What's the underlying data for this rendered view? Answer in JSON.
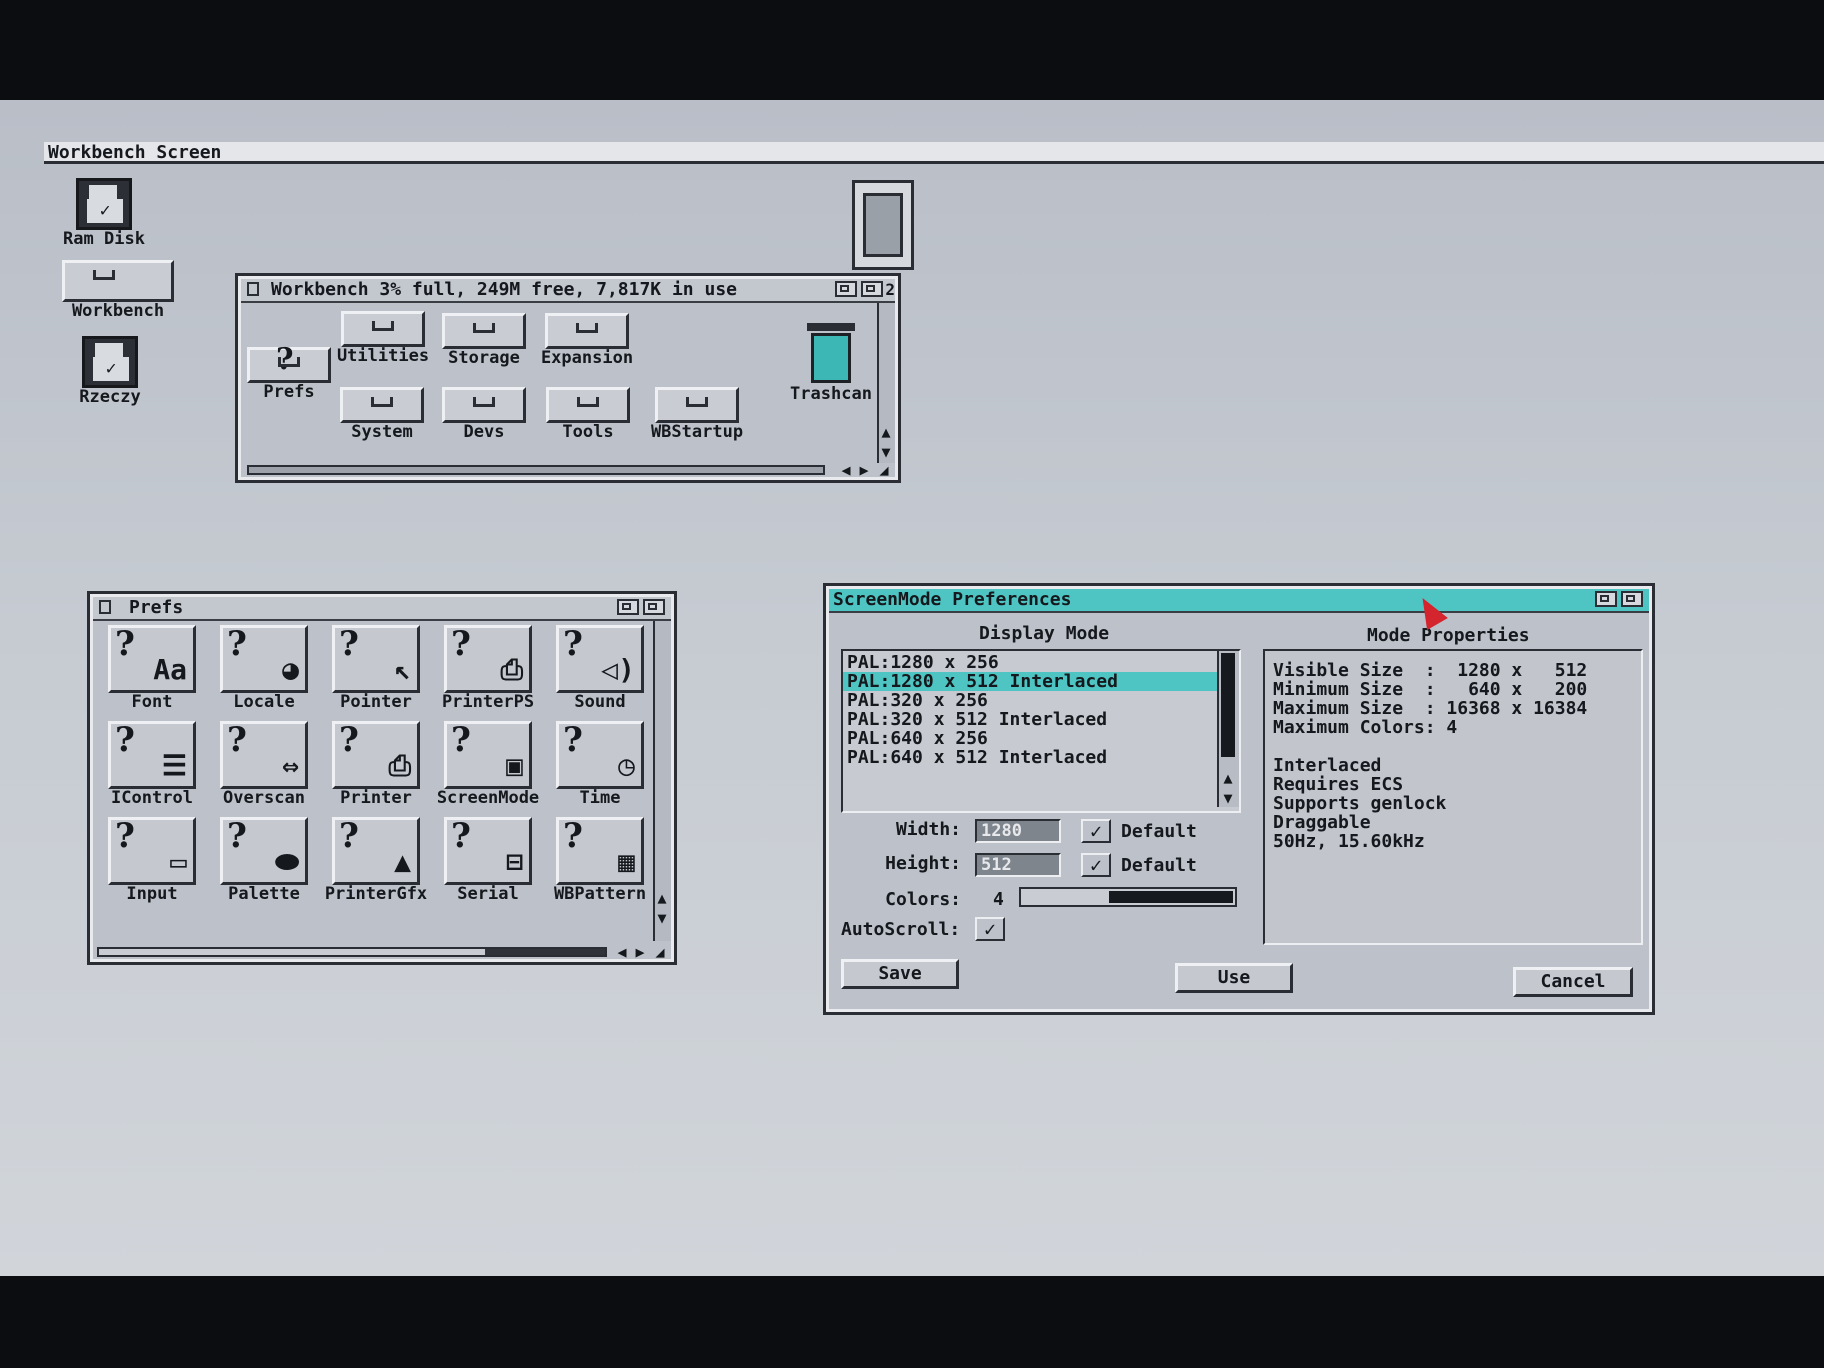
{
  "screen_title": "Workbench Screen",
  "desktop_icons": [
    {
      "label": "Ram Disk"
    },
    {
      "label": "Workbench"
    },
    {
      "label": "Rzeczy"
    }
  ],
  "workbench_window": {
    "title": "Workbench  3% full, 249M free, 7,817K in use",
    "depth_number": "2",
    "items": [
      {
        "label": "Prefs"
      },
      {
        "label": "Utilities"
      },
      {
        "label": "Storage"
      },
      {
        "label": "Expansion"
      },
      {
        "label": "System"
      },
      {
        "label": "Devs"
      },
      {
        "label": "Tools"
      },
      {
        "label": "WBStartup"
      },
      {
        "label": "Trashcan"
      }
    ]
  },
  "prefs_window": {
    "title": "Prefs",
    "items": [
      {
        "label": "Font",
        "icon": "font-icon"
      },
      {
        "label": "Locale",
        "icon": "globe-icon"
      },
      {
        "label": "Pointer",
        "icon": "pointer-icon"
      },
      {
        "label": "PrinterPS",
        "icon": "printer-icon"
      },
      {
        "label": "Sound",
        "icon": "speaker-icon"
      },
      {
        "label": "IControl",
        "icon": "control-icon"
      },
      {
        "label": "Overscan",
        "icon": "overscan-icon"
      },
      {
        "label": "Printer",
        "icon": "printer-icon"
      },
      {
        "label": "ScreenMode",
        "icon": "monitor-icon"
      },
      {
        "label": "Time",
        "icon": "clock-icon"
      },
      {
        "label": "Input",
        "icon": "mouse-icon"
      },
      {
        "label": "Palette",
        "icon": "palette-icon"
      },
      {
        "label": "PrinterGfx",
        "icon": "printer-gfx-icon"
      },
      {
        "label": "Serial",
        "icon": "serial-icon"
      },
      {
        "label": "WBPattern",
        "icon": "pattern-icon"
      }
    ]
  },
  "screenmode": {
    "title": "ScreenMode Preferences",
    "display_mode_header": "Display Mode",
    "mode_props_header": "Mode Properties",
    "modes": [
      "PAL:1280 x 256",
      "PAL:1280 x 512 Interlaced",
      "PAL:320 x 256",
      "PAL:320 x 512 Interlaced",
      "PAL:640 x 256",
      "PAL:640 x 512 Interlaced"
    ],
    "selected_mode_index": 1,
    "width_label": "Width:",
    "width_value": "1280",
    "height_label": "Height:",
    "height_value": "512",
    "default_label": "Default",
    "width_default_checked": "✓",
    "height_default_checked": "✓",
    "colors_label": "Colors:",
    "colors_value": "4",
    "colors_slider_level": 0.6,
    "autoscroll_label": "AutoScroll:",
    "autoscroll_checked": "✓",
    "properties": [
      "Visible Size  :  1280 x   512",
      "Minimum Size  :   640 x   200",
      "Maximum Size  : 16368 x 16384",
      "Maximum Colors: 4",
      "",
      "Interlaced",
      "Requires ECS",
      "Supports genlock",
      "Draggable",
      "50Hz, 15.60kHz"
    ],
    "save_label": "Save",
    "use_label": "Use",
    "cancel_label": "Cancel"
  },
  "colors": {
    "accent": "#4fc5c3",
    "desktop": "#c2c7ce"
  }
}
